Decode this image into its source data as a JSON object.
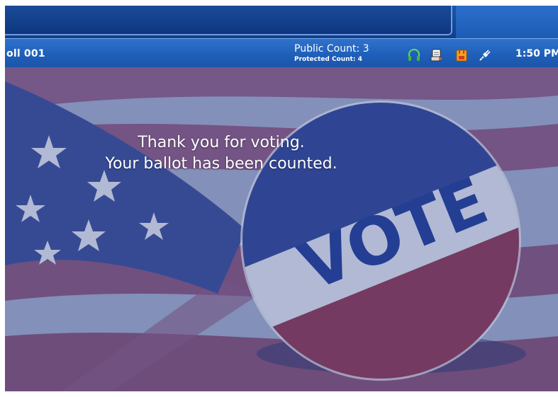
{
  "status_bar": {
    "poll_label": "oll 001",
    "public_count": "Public Count: 3",
    "protected_count": "Protected Count: 4",
    "time": "1:50 PM",
    "icons": [
      "headphones-icon",
      "printer-document-icon",
      "memory-card-icon",
      "power-plug-icon"
    ]
  },
  "message": {
    "line1": "Thank you for voting.",
    "line2": "Your ballot has been counted."
  },
  "background": {
    "button_text": "VOTE",
    "colors": {
      "overlay": "#2d4d92",
      "stripe_red": "#8a5a86",
      "stripe_white": "#b9c2dd",
      "status_bar": "#1f5fba"
    }
  }
}
